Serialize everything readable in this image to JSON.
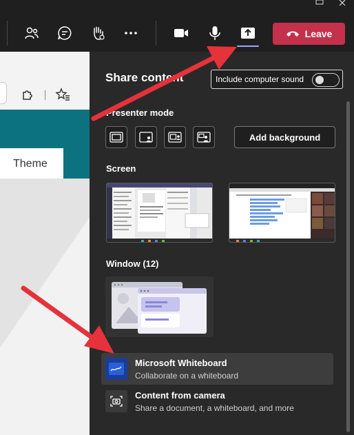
{
  "meeting_toolbar": {
    "leave_label": "Leave",
    "icons": [
      "people-icon",
      "chat-icon",
      "raise-hand-icon",
      "more-icon",
      "camera-icon",
      "mic-icon",
      "share-icon",
      "phone-icon"
    ]
  },
  "background_app": {
    "theme_label": "Theme"
  },
  "share_panel": {
    "title": "Share content",
    "include_sound_label": "Include computer sound",
    "include_sound_on": false,
    "presenter_mode_label": "Presenter mode",
    "add_background_label": "Add background",
    "screen_label": "Screen",
    "window_label": "Window (12)",
    "items": [
      {
        "title": "Microsoft Whiteboard",
        "subtitle": "Collaborate on a whiteboard"
      },
      {
        "title": "Content from camera",
        "subtitle": "Share a document, a whiteboard, and more"
      }
    ]
  },
  "colors": {
    "leave": "#c4314b",
    "panel_bg": "#292929",
    "accent": "#9ea6ff",
    "arrow": "#e5323b",
    "teal": "#0d7280"
  }
}
